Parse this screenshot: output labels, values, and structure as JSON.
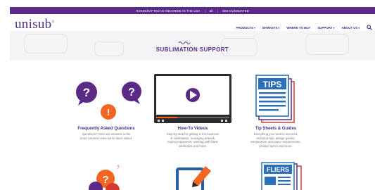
{
  "topbar": {
    "items": [
      "HANDCRAFTED IN ANCONIDE IN THE USA",
      "all",
      "SEE DUNSDATED"
    ]
  },
  "header": {
    "logo": "unisub",
    "logo_mark": "®",
    "nav": [
      "PRODUCTS",
      "MARKETS",
      "WHERE TO BUY",
      "SUPPORT",
      "ABOUT US"
    ]
  },
  "page": {
    "title": "SUBLIMATION SUPPORT"
  },
  "cards": [
    {
      "title": "Frequently Asked Questions",
      "lines": [
        "Questions? Here are answers to the",
        "most common ones we've been asked."
      ]
    },
    {
      "title": "How-To Videos",
      "lines": [
        "Step-by-step for getting in the business",
        "of sublimation, managing artwork,",
        "buying equipment, working with blank",
        "substrates and more."
      ]
    },
    {
      "title": "Tip Sheets & Guides",
      "lines": [
        "Everything you need to succeed,",
        "technical tips, design guides,",
        "temperature and paper requirements,",
        "product specs and more."
      ]
    }
  ],
  "tiles": {
    "tips_label": "TIPS",
    "fliers_label": "FLIERS"
  },
  "colors": {
    "brand_purple": "#5b2a86",
    "accent_orange": "#f26522",
    "accent_red": "#d63a2f"
  }
}
